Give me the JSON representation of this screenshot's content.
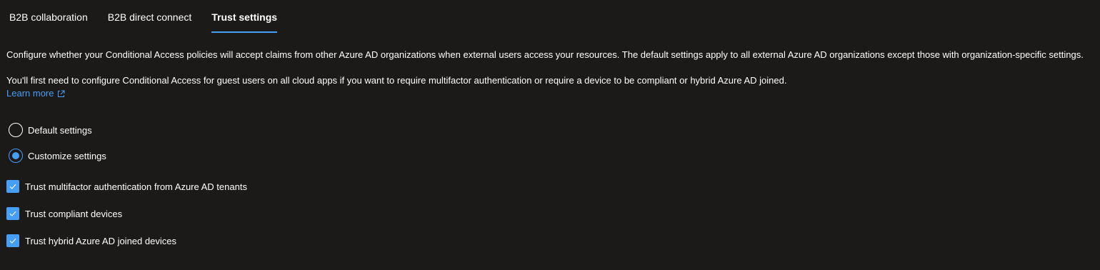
{
  "tabs": [
    {
      "label": "B2B collaboration",
      "active": false
    },
    {
      "label": "B2B direct connect",
      "active": false
    },
    {
      "label": "Trust settings",
      "active": true
    }
  ],
  "description": "Configure whether your Conditional Access policies will accept claims from other Azure AD organizations when external users access your resources. The default settings apply to all external Azure AD organizations except those with organization-specific settings.",
  "note": "You'll first need to configure Conditional Access for guest users on all cloud apps if you want to require multifactor authentication or require a device to be compliant or hybrid Azure AD joined.",
  "learn_more": {
    "label": "Learn more",
    "icon": "external-link-icon"
  },
  "settings_mode": {
    "options": [
      {
        "label": "Default settings",
        "selected": false
      },
      {
        "label": "Customize settings",
        "selected": true
      }
    ]
  },
  "trust_options": [
    {
      "label": "Trust multifactor authentication from Azure AD tenants",
      "checked": true
    },
    {
      "label": "Trust compliant devices",
      "checked": true
    },
    {
      "label": "Trust hybrid Azure AD joined devices",
      "checked": true
    }
  ],
  "colors": {
    "background": "#1b1a19",
    "accent": "#479ef5",
    "text": "#ffffff"
  }
}
